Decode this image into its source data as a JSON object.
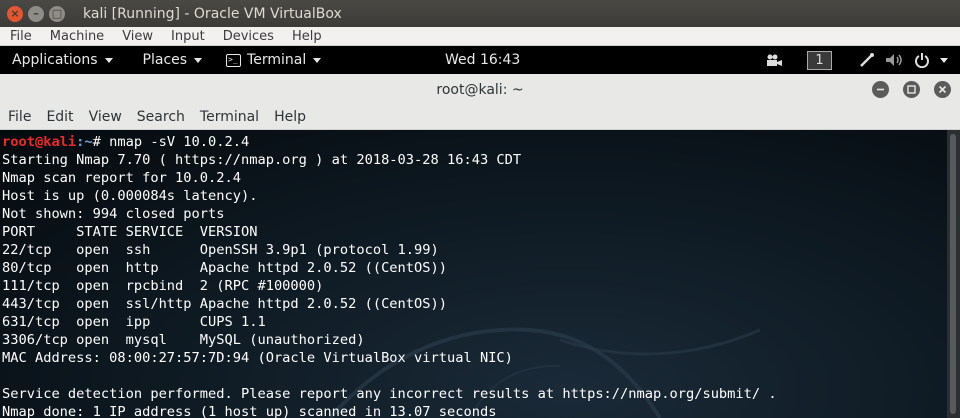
{
  "vbox": {
    "title": "kali [Running] - Oracle VM VirtualBox",
    "menu": [
      "File",
      "Machine",
      "View",
      "Input",
      "Devices",
      "Help"
    ]
  },
  "gnome": {
    "applications": "Applications",
    "places": "Places",
    "terminal": "Terminal",
    "clock": "Wed 16:43",
    "workspace": "1"
  },
  "terminal": {
    "title": "root@kali: ~",
    "menu": [
      "File",
      "Edit",
      "View",
      "Search",
      "Terminal",
      "Help"
    ],
    "prompt_user": "root@kali",
    "prompt_path": ":~",
    "prompt_suffix": "# nmap -sV 10.0.2.4",
    "lines": [
      "Starting Nmap 7.70 ( https://nmap.org ) at 2018-03-28 16:43 CDT",
      "Nmap scan report for 10.0.2.4",
      "Host is up (0.000084s latency).",
      "Not shown: 994 closed ports",
      "PORT     STATE SERVICE  VERSION",
      "22/tcp   open  ssh      OpenSSH 3.9p1 (protocol 1.99)",
      "80/tcp   open  http     Apache httpd 2.0.52 ((CentOS))",
      "111/tcp  open  rpcbind  2 (RPC #100000)",
      "443/tcp  open  ssl/http Apache httpd 2.0.52 ((CentOS))",
      "631/tcp  open  ipp      CUPS 1.1",
      "3306/tcp open  mysql    MySQL (unauthorized)",
      "MAC Address: 08:00:27:57:7D:94 (Oracle VirtualBox virtual NIC)",
      "",
      "Service detection performed. Please report any incorrect results at https://nmap.org/submit/ .",
      "Nmap done: 1 IP address (1 host up) scanned in 13.07 seconds"
    ]
  },
  "colors": {
    "prompt_user": "#ef2929",
    "prompt_path": "#729fcf",
    "close_button": "#e2572f"
  }
}
